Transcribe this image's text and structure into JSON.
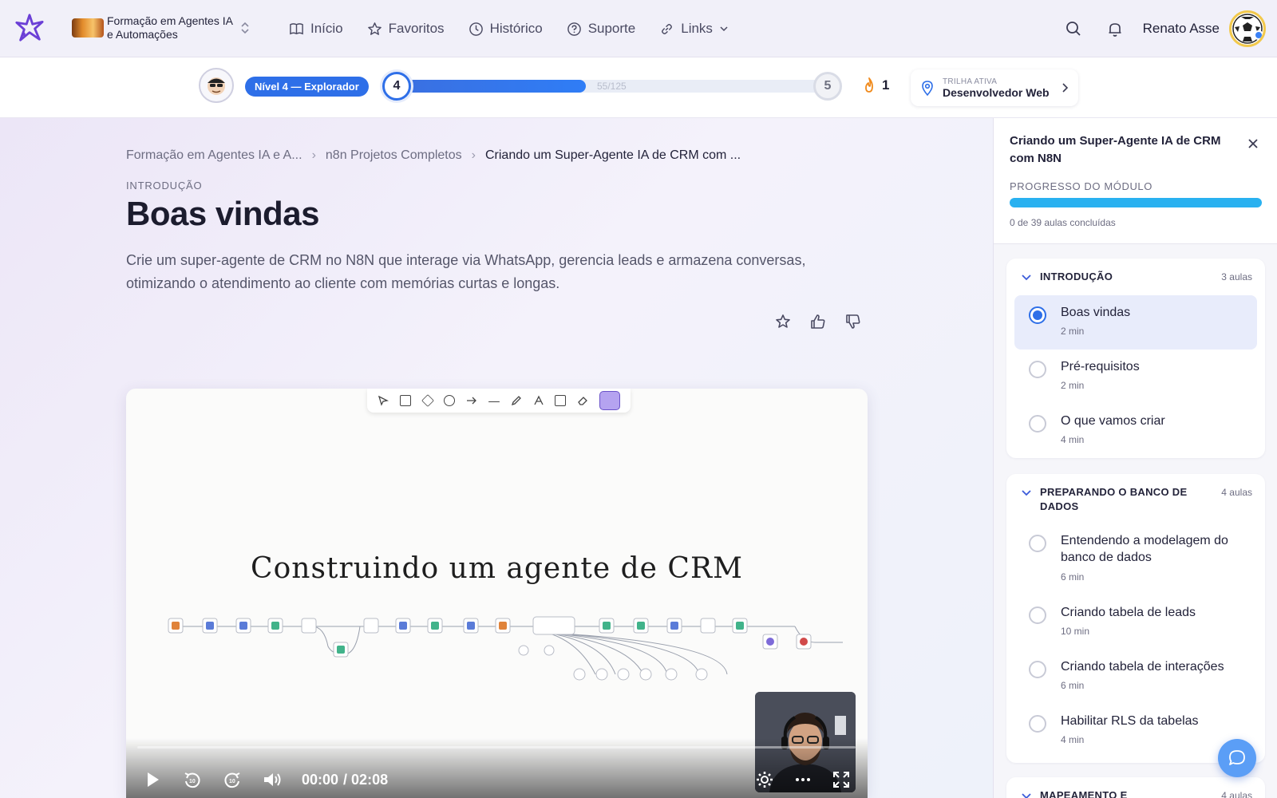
{
  "header": {
    "course_name": "Formação em Agentes IA e Automações",
    "nav": [
      {
        "label": "Início",
        "icon": "book-icon"
      },
      {
        "label": "Favoritos",
        "icon": "star-icon"
      },
      {
        "label": "Histórico",
        "icon": "clock-icon"
      },
      {
        "label": "Suporte",
        "icon": "help-circle-icon"
      },
      {
        "label": "Links",
        "icon": "link-icon"
      }
    ],
    "user_name": "Renato Asse"
  },
  "progress": {
    "level_label": "Nível 4 — Explorador",
    "current_level": "4",
    "next_level": "5",
    "xp_text": "55/125",
    "xp_fraction": 0.44,
    "streak": "1",
    "trail_label": "TRILHA ATIVA",
    "trail_name": "Desenvolvedor Web"
  },
  "main": {
    "breadcrumb": [
      "Formação em Agentes IA e A...",
      "n8n Projetos Completos",
      "Criando um Super-Agente IA de CRM com ..."
    ],
    "eyebrow": "INTRODUÇÃO",
    "title": "Boas vindas",
    "description": "Crie um super-agente de CRM no N8N que interage via WhatsApp, gerencia leads e armazena conversas, otimizando o atendimento ao cliente com memórias curtas e longas."
  },
  "video": {
    "heading": "Construindo um agente de CRM",
    "current_time": "00:00",
    "duration": "/ 02:08"
  },
  "sidebar": {
    "title": "Criando um Super-Agente IA de CRM com N8N",
    "progress_label": "PROGRESSO DO MÓDULO",
    "progress_count": "0 de 39 aulas concluídas",
    "sections": [
      {
        "title": "INTRODUÇÃO",
        "count": "3 aulas",
        "lessons": [
          {
            "name": "Boas vindas",
            "duration": "2 min",
            "active": true
          },
          {
            "name": "Pré-requisitos",
            "duration": "2 min",
            "active": false
          },
          {
            "name": "O que vamos criar",
            "duration": "4 min",
            "active": false
          }
        ]
      },
      {
        "title": "PREPARANDO O BANCO DE DADOS",
        "count": "4 aulas",
        "lessons": [
          {
            "name": "Entendendo a modelagem do banco de dados",
            "duration": "6 min",
            "active": false
          },
          {
            "name": "Criando tabela de leads",
            "duration": "10 min",
            "active": false
          },
          {
            "name": "Criando tabela de interações",
            "duration": "6 min",
            "active": false
          },
          {
            "name": "Habilitar RLS da tabelas",
            "duration": "4 min",
            "active": false
          }
        ]
      },
      {
        "title": "MAPEAMENTO E",
        "count": "4 aulas",
        "lessons": []
      }
    ]
  },
  "colors": {
    "accent": "#2e6fe8",
    "progress_bar": "#29b1f0",
    "chat_button": "#5b9ef6"
  }
}
